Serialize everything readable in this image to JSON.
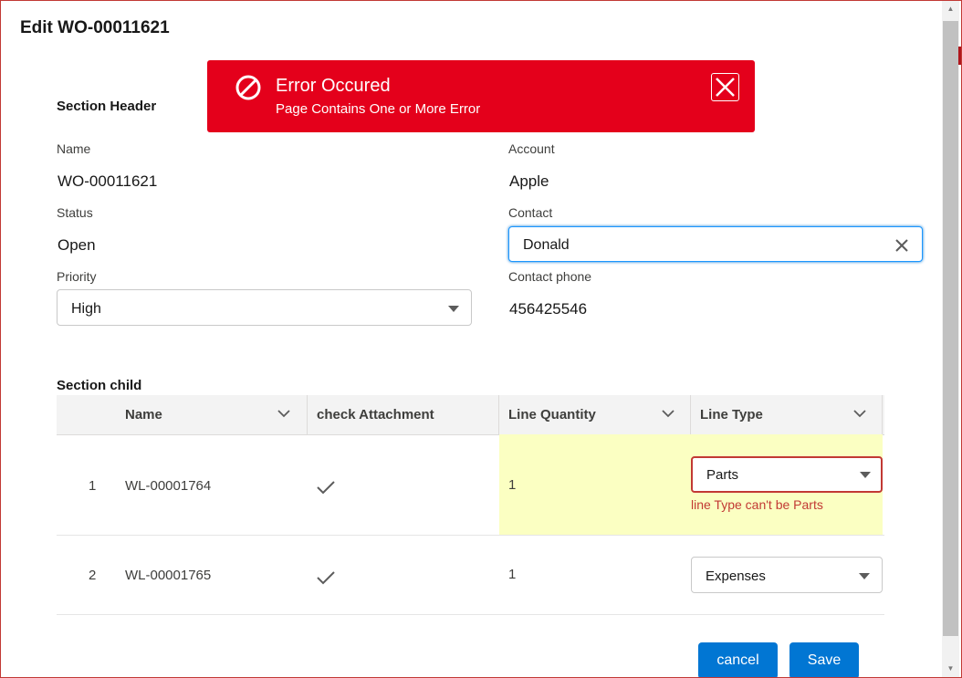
{
  "modal": {
    "title": "Edit WO-00011621"
  },
  "toast": {
    "title": "Error Occured",
    "message": "Page Contains One or More Error",
    "color": "#e4001b"
  },
  "header_section": {
    "title": "Section Header",
    "name_label": "Name",
    "name_value": "WO-00011621",
    "account_label": "Account",
    "account_value": "Apple",
    "status_label": "Status",
    "status_value": "Open",
    "contact_label": "Contact",
    "contact_value": "Donald",
    "priority_label": "Priority",
    "priority_value": "High",
    "contact_phone_label": "Contact phone",
    "contact_phone_value": "456425546"
  },
  "child_section": {
    "title": "Section child",
    "columns": [
      "Name",
      "check Attachment",
      "Line Quantity",
      "Line Type"
    ],
    "rows": [
      {
        "num": "1",
        "name": "WL-00001764",
        "check_attachment": true,
        "line_quantity": "1",
        "line_type": "Parts",
        "error": "line Type can't be Parts"
      },
      {
        "num": "2",
        "name": "WL-00001765",
        "check_attachment": true,
        "line_quantity": "1",
        "line_type": "Expenses",
        "error": ""
      }
    ]
  },
  "footer": {
    "cancel_label": "cancel",
    "save_label": "Save"
  },
  "colors": {
    "brand": "#0176d3",
    "error": "#c23934",
    "highlight": "#fbffc2"
  }
}
